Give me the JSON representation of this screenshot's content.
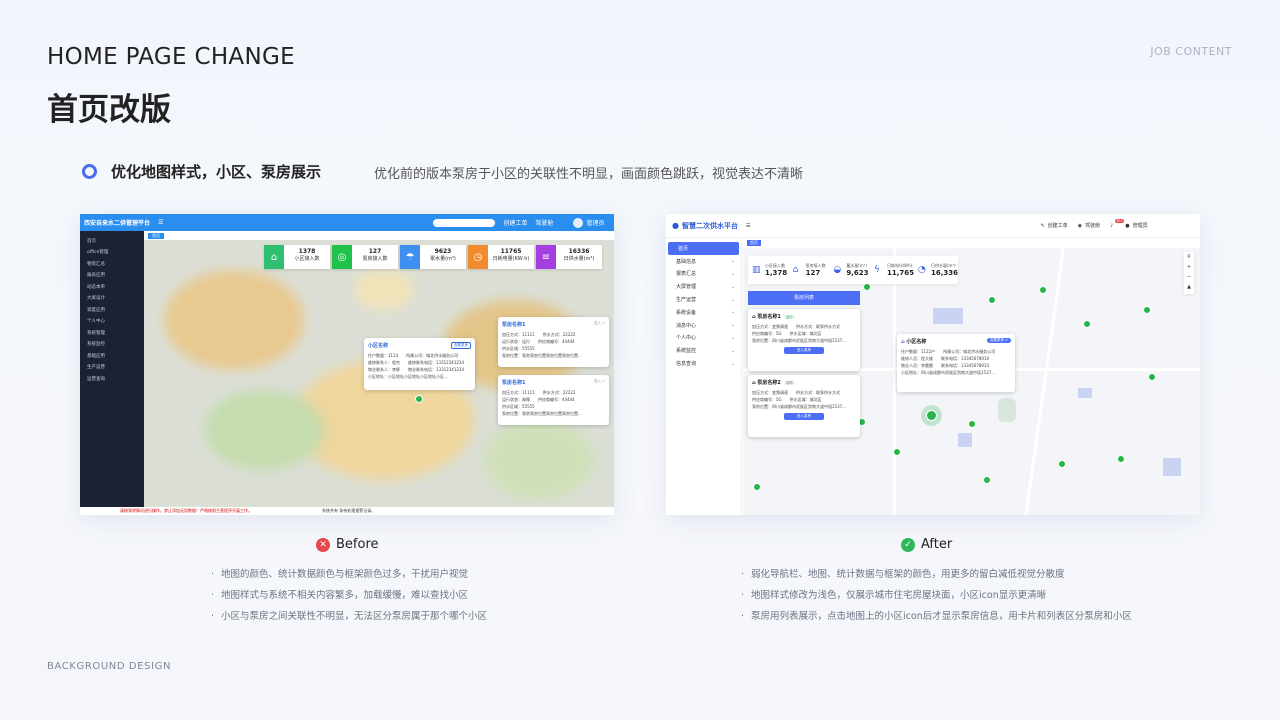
{
  "header": {
    "title_en": "HOME PAGE CHANGE",
    "title_cn": "首页改版",
    "job": "JOB CONTENT",
    "footer": "BACKGROUND DESIGN"
  },
  "section": {
    "title": "优化地图样式，小区、泵房展示",
    "desc": "优化前的版本泵房于小区的关联性不明显，画面颜色跳跃，视觉表达不清晰"
  },
  "before": {
    "label": "Before",
    "status_color": "#e5484d",
    "app_title": "西安自来水二供管理平台",
    "top_actions": [
      "创建工单",
      "驾驶舱",
      "管理员"
    ],
    "tab": "首页",
    "sidebar": [
      "首页",
      "office管理",
      "物资汇总",
      "报表应用",
      "动态本单",
      "大屏设计",
      "调度应用",
      "个人中心",
      "系统管理",
      "系统监控",
      "基础应用",
      "生产运营",
      "运营查询"
    ],
    "stats": [
      {
        "value": "1378",
        "label": "小区接入数",
        "color": "#2fbf71",
        "icon": "⌂"
      },
      {
        "value": "127",
        "label": "泵房接入数",
        "color": "#21c24b",
        "icon": "◎"
      },
      {
        "value": "9623",
        "label": "累水量(m³)",
        "color": "#3f8ff0",
        "icon": "☂"
      },
      {
        "value": "11765",
        "label": "日耗电量(KW·h)",
        "color": "#f08c2e",
        "icon": "◷"
      },
      {
        "value": "16336",
        "label": "日供水量(m³)",
        "color": "#a33ee0",
        "icon": "≡"
      }
    ],
    "community": {
      "name": "小区名称",
      "btn": "查看泵房",
      "rows": [
        "住户数量：1114　　所属公司：城北供水服务公司",
        "维修联系人：程杰　　维修联系电话：13312341234",
        "物业联系人：李辉　　物业联系电话：13312341234",
        "小区地址：小区地址小区地址小区地址小区..."
      ]
    },
    "pumps": [
      {
        "name": "泵房名称1",
        "more": "进入 >",
        "rows": [
          "加压方式：11111　　供水方式：22222",
          "运行状态：运行　　供应商编号：44444",
          "供水区域：55555",
          "泵房位置：泵房泵房位置泵房位置泵房位置..."
        ]
      },
      {
        "name": "泵房名称1",
        "more": "进入 >",
        "rows": [
          "加压方式：11111　　供水方式：22222",
          "运行状态：故障　　供应商编号：44444",
          "供水区域：55555",
          "泵房位置：泵房泵房位置泵房位置泵房位置..."
        ]
      }
    ],
    "footer_text": "请按泵除情况进行操作。禁止添加无用数据！严格按照主营程序开展工作。",
    "footer_right": "系统共有 条待处理报警记录。",
    "bullets": [
      "地图的颜色、统计数据颜色与框架颜色过多，干扰用户视觉",
      "地图样式与系统不相关内容繁多，加载缓慢，难以查找小区",
      "小区与泵房之间关联性不明显，无法区分泵房属于那个哪个小区"
    ]
  },
  "after": {
    "label": "After",
    "status_color": "#2fb85a",
    "app_title": "智慧二次供水平台",
    "top_actions": [
      "创建工单",
      "驾驶舱",
      "管理员"
    ],
    "badge": "99+",
    "tab": "首页",
    "sidebar": [
      "首页",
      "基础信息",
      "报表汇总",
      "大屏管理",
      "生产运营",
      "系统设备",
      "消息中心",
      "个人中心",
      "系统监控",
      "信息查询"
    ],
    "stats": [
      {
        "label": "小区接入数",
        "value": "1,378",
        "icon": "▥"
      },
      {
        "label": "泵房接入数",
        "value": "127",
        "icon": "⌂"
      },
      {
        "label": "蓄水量(m³)",
        "value": "9,623",
        "icon": "◒"
      },
      {
        "label": "日耗电(kW/h)",
        "value": "11,765",
        "icon": "ϟ"
      },
      {
        "label": "日供水量(m³)",
        "value": "16,336",
        "icon": "◔"
      }
    ],
    "pump_list": {
      "title": "泵房列表",
      "items": [
        {
          "name": "泵房名称1",
          "tag": "运行",
          "rows": [
            "加压方式：变频调速　　供水方式：联泵供水方式",
            "供应商编号：5G　　供水区域：城北区",
            "泵房位置：四川省成都市武侯区剑南大道中段1537..."
          ],
          "btn": "进入泵房"
        },
        {
          "name": "泵房名称2",
          "tag": "故障",
          "rows": [
            "加压方式：变频调速　　供水方式：联泵供水方式",
            "供应商编号：5G　　供水区域：城北区",
            "泵房位置：四川省成都市武侯区剑南大道中段1537..."
          ],
          "btn": "进入泵房"
        }
      ]
    },
    "community": {
      "name": "小区名称",
      "btn": "查看泵房 >",
      "rows": [
        "住户数量：1122户　　所属公司：城北供水服务公司",
        "维修人员：程大维　　联系电话：13345678910",
        "物业人员：李雷雷　　联系电话：13345678910",
        "小区地址：四川省成都市武侯区剑南大道中段1537..."
      ]
    },
    "bullets": [
      "弱化导航栏、地图、统计数据与框架的颜色，用更多的留白减低视觉分散度",
      "地图样式修改为浅色，仅展示城市住宅房屋块面，小区icon显示更清晰",
      "泵房用列表展示，点击地图上的小区icon后才显示泵房信息，用卡片和列表区分泵房和小区"
    ]
  }
}
